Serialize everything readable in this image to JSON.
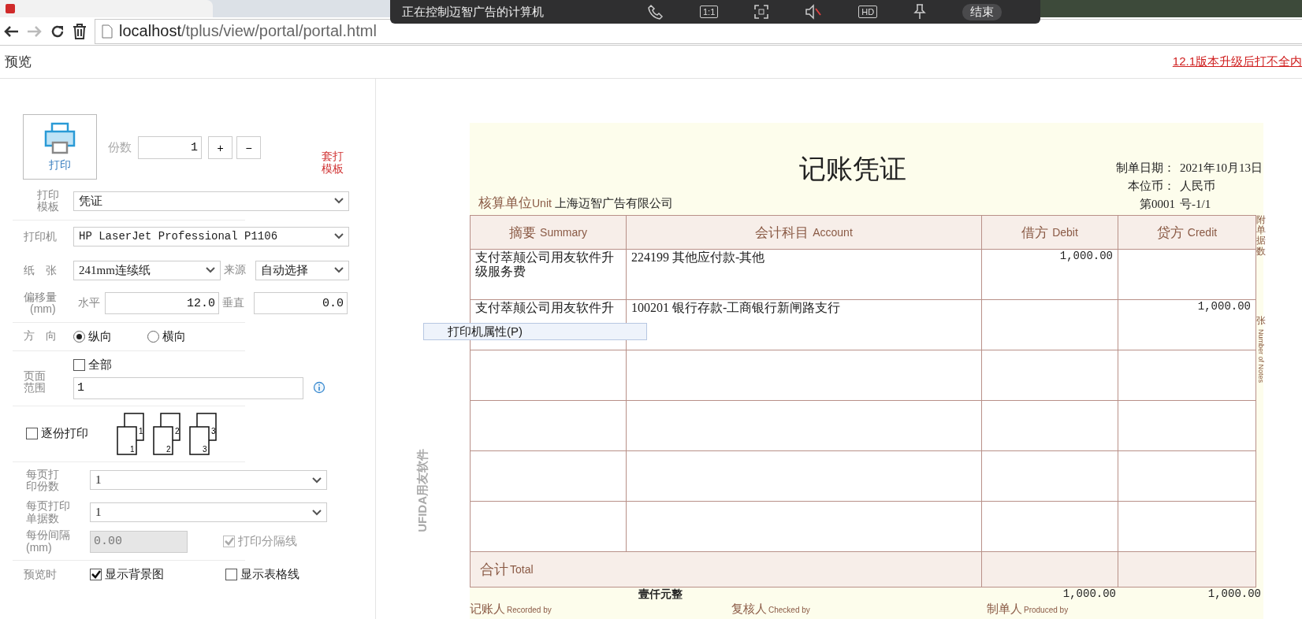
{
  "remote_bar": {
    "title": "正在控制迈智广告的计算机",
    "ratio_label": "1:1",
    "hd_label": "HD",
    "end_button": "结束"
  },
  "address_bar": {
    "url_host": "localhost",
    "url_path": "/tplus/view/portal/portal.html"
  },
  "header": {
    "title": "预览",
    "notice_link": "12.1版本升级后打不全内"
  },
  "print_panel": {
    "print_button": "打印",
    "copies": {
      "label": "份数",
      "value": "1",
      "plus": "+",
      "minus": "−"
    },
    "template_link": "套打模板",
    "template": {
      "label": "打印模板",
      "value": "凭证"
    },
    "printer": {
      "label": "打印机",
      "value": "HP LaserJet Professional P1106"
    },
    "paper": {
      "label": "纸　张",
      "value": "241mm连续纸"
    },
    "source": {
      "label": "来源",
      "value": "自动选择"
    },
    "offset": {
      "label": "偏移量",
      "unit": "(mm)",
      "horizontal_label": "水平",
      "horizontal": "12.0",
      "vertical_label": "垂直",
      "vertical": "0.0"
    },
    "orientation": {
      "label": "方　向",
      "options": [
        {
          "label": "纵向",
          "selected": true
        },
        {
          "label": "横向",
          "selected": false
        }
      ]
    },
    "page_range": {
      "label": "页面范围",
      "all_label": "全部",
      "all_checked": false,
      "value": "1"
    },
    "collate": {
      "label": "逐份打印",
      "checked": false,
      "pages": [
        {
          "front": "1",
          "back": "1"
        },
        {
          "front": "2",
          "back": "2"
        },
        {
          "front": "3",
          "back": "3"
        }
      ]
    },
    "copies_per_page": {
      "label": "每页打印份数",
      "value": "1"
    },
    "docs_per_page": {
      "label": "每页打印单据数",
      "value": "1"
    },
    "gap": {
      "label": "每份间隔",
      "unit": "(mm)",
      "value": "0.00",
      "disabled": true
    },
    "separator": {
      "label": "打印分隔线",
      "checked": true,
      "disabled": true
    },
    "preview": {
      "label": "预览时",
      "options": [
        {
          "label": "显示背景图",
          "checked": true
        },
        {
          "label": "显示表格线",
          "checked": false
        }
      ]
    }
  },
  "context_menu": {
    "items": [
      "打印机属性(P)"
    ]
  },
  "voucher": {
    "brand": "UFIDA用友软件",
    "title": "记账凭证",
    "unit_label": "核算单位",
    "unit_label_en": "Unit",
    "unit_name": "上海迈智广告有限公司",
    "meta": [
      {
        "label": "制单日期：",
        "value": "2021年10月13日"
      },
      {
        "label": "本位币：",
        "value": "人民币"
      },
      {
        "label": "第0001",
        "value": "号-1/1"
      }
    ],
    "columns": [
      {
        "label": "摘要",
        "label_en": "Summary"
      },
      {
        "label": "会计科目",
        "label_en": "Account"
      },
      {
        "label": "借方",
        "label_en": "Debit"
      },
      {
        "label": "贷方",
        "label_en": "Credit"
      }
    ],
    "rows": [
      {
        "summary": "支付萃颠公司用友软件升级服务费",
        "account": "224199 其他应付款-其他",
        "debit": "1,000.00"
      },
      {
        "summary": "支付萃颠公司用友软件升",
        "account": "100201 银行存款-工商银行新闸路支行",
        "credit": "1,000.00"
      }
    ],
    "total": {
      "label": "合计",
      "label_en": "Total",
      "amount_words": "壹仟元整",
      "debit": "1,000.00",
      "credit": "1,000.00"
    },
    "signatures": [
      {
        "label": "记账人",
        "label_en": "Recorded by"
      },
      {
        "label": "复核人",
        "label_en": "Checked by"
      },
      {
        "label": "制单人",
        "label_en": "Produced by"
      }
    ],
    "side_notes": {
      "attachments": "附单据数",
      "sheets": "张",
      "sheets_en": "Number of Notes"
    }
  }
}
